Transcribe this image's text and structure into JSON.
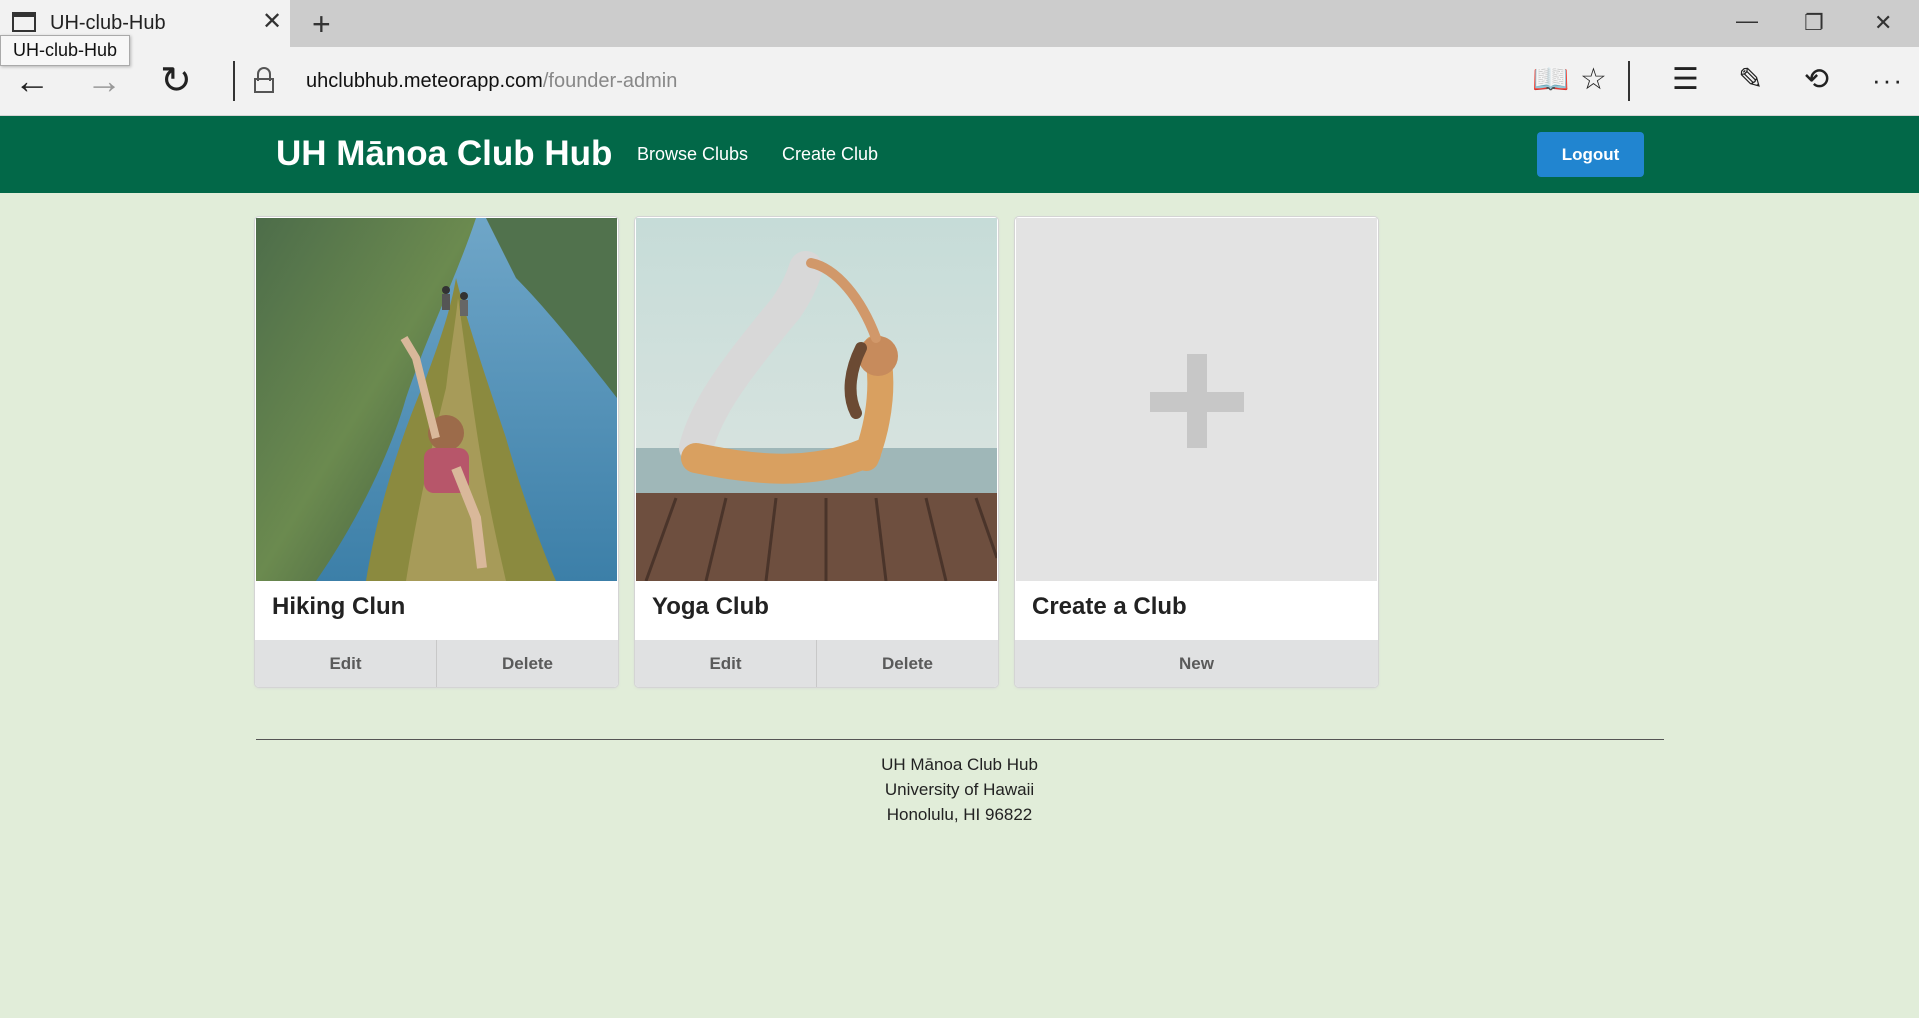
{
  "browser": {
    "tab_title": "UH-club-Hub",
    "tooltip": "UH-club-Hub",
    "url_domain": "uhclubhub.meteorapp.com",
    "url_path": "/founder-admin",
    "icons": [
      "tab-page-icon",
      "close-tab-icon",
      "new-tab-icon",
      "minimize-icon",
      "restore-icon",
      "close-window-icon",
      "back-arrow-icon",
      "forward-arrow-icon",
      "refresh-icon",
      "lock-icon",
      "reading-view-icon",
      "favorite-star-icon",
      "hub-icon",
      "web-note-icon",
      "share-icon",
      "more-icon"
    ]
  },
  "navbar": {
    "brand": "UH Mānoa Club Hub",
    "links": [
      "Browse Clubs",
      "Create Club"
    ],
    "logout": "Logout",
    "color": "#026848",
    "logout_color": "#2185d0"
  },
  "cards": [
    {
      "title": "Hiking Clun",
      "actions": [
        "Edit",
        "Delete"
      ]
    },
    {
      "title": "Yoga Club",
      "actions": [
        "Edit",
        "Delete"
      ]
    },
    {
      "title": "Create a Club",
      "actions": [
        "New"
      ]
    }
  ],
  "footer": {
    "lines": [
      "UH Mānoa Club Hub",
      "University of Hawaii",
      "Honolulu, HI 96822"
    ]
  },
  "colors": {
    "page_background": "#e1edd9"
  }
}
